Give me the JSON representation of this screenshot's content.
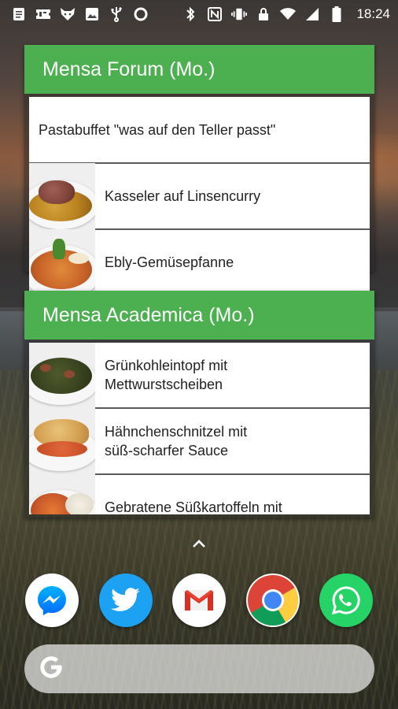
{
  "status_bar": {
    "time": "18:24",
    "left_icons": [
      "notes-icon",
      "ticket-icon",
      "fox-icon",
      "image-icon",
      "usb-icon",
      "circle-icon"
    ],
    "right_icons": [
      "bluetooth-icon",
      "nfc-icon",
      "vibrate-icon",
      "lock-icon",
      "wifi-icon",
      "cell-signal-icon",
      "battery-icon"
    ]
  },
  "widgets": [
    {
      "title": "Mensa Forum (Mo.)",
      "items": [
        {
          "label": "Pastabuffet \"was auf den Teller passt\"",
          "has_image": false
        },
        {
          "label": "Kasseler auf Linsencurry",
          "has_image": true,
          "image": "kasseler-photo"
        },
        {
          "label": "Ebly-Gemüsepfanne",
          "has_image": true,
          "image": "ebly-photo"
        }
      ]
    },
    {
      "title": "Mensa Academica (Mo.)",
      "items": [
        {
          "label_line1": "Grünkohleintopf mit",
          "label_line2": "Mettwurstscheiben",
          "has_image": true,
          "image": "gruenkohl-photo"
        },
        {
          "label_line1": "Hähnchenschnitzel mit",
          "label_line2": "süß-scharfer Sauce",
          "has_image": true,
          "image": "schnitzel-photo"
        },
        {
          "label": "Gebratene Süßkartoffeln mit",
          "has_image": true,
          "image": "suesskartoffel-photo"
        }
      ]
    }
  ],
  "dock": [
    {
      "name": "messenger",
      "icon": "messenger-icon",
      "color": "#ffffff"
    },
    {
      "name": "twitter",
      "icon": "twitter-icon",
      "color": "#1da1f2"
    },
    {
      "name": "gmail",
      "icon": "gmail-icon",
      "color": "#ffffff"
    },
    {
      "name": "chrome",
      "icon": "chrome-icon",
      "color": "#ffffff"
    },
    {
      "name": "whatsapp",
      "icon": "whatsapp-icon",
      "color": "#25d366"
    }
  ],
  "search": {
    "icon": "google-g-icon"
  },
  "colors": {
    "accent_green": "#4caf50"
  }
}
